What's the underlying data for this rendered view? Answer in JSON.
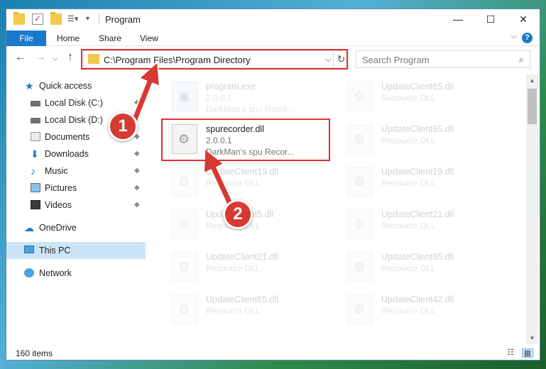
{
  "window": {
    "title": "Program",
    "minimize": "—",
    "maximize": "☐",
    "close": "✕"
  },
  "ribbon": {
    "file": "File",
    "home": "Home",
    "share": "Share",
    "view": "View",
    "help": "?",
    "collapse": "⌵"
  },
  "nav": {
    "back": "←",
    "forward": "→",
    "recent": "⌵",
    "up": "↑",
    "address": "C:\\Program Files\\Program Directory",
    "address_dropdown": "⌵",
    "refresh": "↻",
    "search_placeholder": "Search Program",
    "search_icon": "⌕"
  },
  "sidebar": {
    "items": [
      {
        "label": "Quick access",
        "icon": "star-icon"
      },
      {
        "label": "Local Disk (C:)",
        "icon": "disk-icon",
        "pinned": true
      },
      {
        "label": "Local Disk (D:)",
        "icon": "disk-icon",
        "pinned": true
      },
      {
        "label": "Documents",
        "icon": "documents-icon",
        "pinned": true
      },
      {
        "label": "Downloads",
        "icon": "download-icon",
        "pinned": true
      },
      {
        "label": "Music",
        "icon": "music-icon",
        "pinned": true
      },
      {
        "label": "Pictures",
        "icon": "pictures-icon",
        "pinned": true
      },
      {
        "label": "Videos",
        "icon": "videos-icon",
        "pinned": true
      },
      {
        "label": "OneDrive",
        "icon": "cloud-icon"
      },
      {
        "label": "This PC",
        "icon": "pc-icon",
        "selected": true
      },
      {
        "label": "Network",
        "icon": "network-icon"
      }
    ],
    "pin_glyph": "📌"
  },
  "files": {
    "left": [
      {
        "name": "program.exe",
        "line2": "2.0.0.1",
        "line3": "DarkMan's spu Recor...",
        "faded": true
      },
      {
        "name": "spurecorder.dll",
        "line2": "2.0.0.1",
        "line3": "DarkMan's spu Recor...",
        "faded": false
      },
      {
        "name": "UpdateClient19.dll",
        "line2": "Resource DLL",
        "faded": true
      },
      {
        "name": "UpdateClient5.dll",
        "line2": "Resource DLL",
        "faded": true
      },
      {
        "name": "UpdateClient21.dll",
        "line2": "Resource DLL",
        "faded": true
      },
      {
        "name": "UpdateClient65.dll",
        "line2": "Resource DLL",
        "faded": true
      }
    ],
    "right": [
      {
        "name": "UpdateClient65.dll",
        "line2": "Resource DLL"
      },
      {
        "name": "UpdateClient65.dll",
        "line2": "Resource DLL"
      },
      {
        "name": "UpdateClient19.dll",
        "line2": "Resource DLL"
      },
      {
        "name": "UpdateClient21.dll",
        "line2": "Resource DLL"
      },
      {
        "name": "UpdateClient65.dll",
        "line2": "Resource DLL"
      },
      {
        "name": "UpdateClient42.dll",
        "line2": "Resource DLL"
      }
    ]
  },
  "status": {
    "count": "160 items",
    "details_view": "☷",
    "tiles_view": "▦"
  },
  "callouts": [
    {
      "number": "1"
    },
    {
      "number": "2"
    }
  ],
  "colors": {
    "accent": "#1979ca",
    "highlight": "#e03030",
    "badge": "#d63a32",
    "selected_bg": "#cce4f7"
  }
}
